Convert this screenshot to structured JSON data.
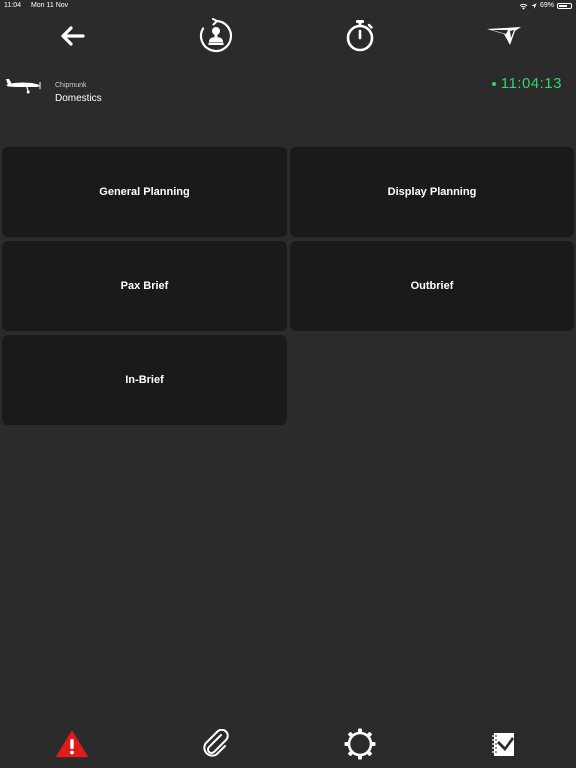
{
  "status_bar": {
    "time": "11:04",
    "date": "Mon 11 Nov",
    "battery": "69%",
    "battery_level": 0.69
  },
  "toolbar": {
    "icons": {
      "back": "back-arrow-icon",
      "stamp": "stamp-rotate-icon",
      "timer": "stopwatch-icon",
      "logo": "app-logo-icon"
    }
  },
  "aircraft": {
    "type": "Chipmunk",
    "mission": "Domestics"
  },
  "clock": {
    "time": "11:04:13",
    "color": "#35d46a"
  },
  "tiles": [
    {
      "label": "General Planning"
    },
    {
      "label": "Display Planning"
    },
    {
      "label": "Pax Brief"
    },
    {
      "label": "Outbrief"
    },
    {
      "label": "In-Brief"
    }
  ],
  "bottom_bar": {
    "icons": {
      "warning": "warning-icon",
      "attachment": "paperclip-icon",
      "settings": "gear-icon",
      "sign": "signature-icon"
    },
    "warning_color": "#e01b1b"
  }
}
